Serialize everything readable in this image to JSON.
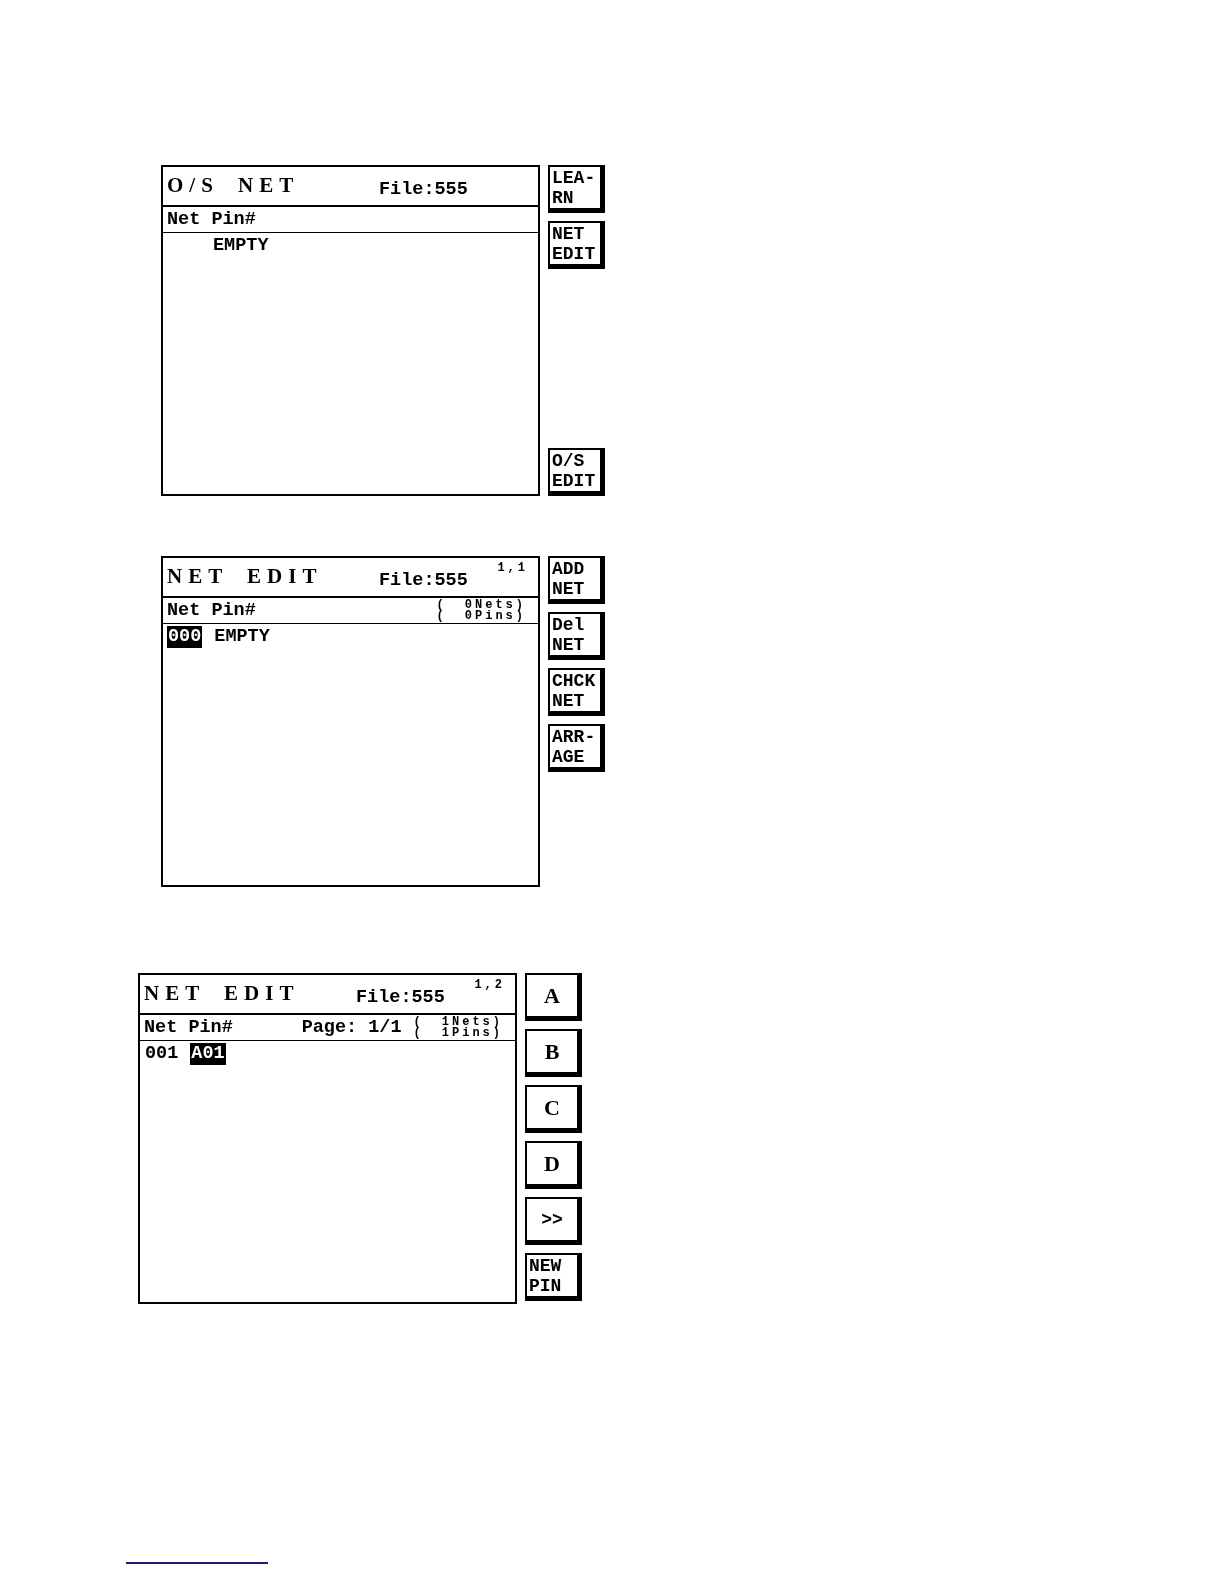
{
  "screens": [
    {
      "title": "O/S NET",
      "file": "File:555",
      "header": {
        "column_label": "Net Pin#"
      },
      "rows": [
        {
          "pin": {
            "text": "EMPTY",
            "selected": false
          }
        }
      ],
      "side_buttons": [
        {
          "kind": "label",
          "lines": [
            "LEA-",
            "RN"
          ]
        },
        {
          "kind": "label",
          "lines": [
            "NET",
            "EDIT"
          ]
        }
      ],
      "bottom_buttons": [
        {
          "kind": "label",
          "lines": [
            "O/S",
            "EDIT"
          ]
        }
      ]
    },
    {
      "title": "NET EDIT",
      "file": "File:555",
      "cursor": "1,1",
      "header": {
        "column_label": "Net Pin#",
        "counts": [
          {
            "bracket": "(",
            "count": "0Nets)"
          },
          {
            "bracket": "(",
            "count": "0Pins)"
          }
        ]
      },
      "rows": [
        {
          "net": {
            "text": "000",
            "selected": true
          },
          "pin": {
            "text": "EMPTY",
            "selected": false
          }
        }
      ],
      "side_buttons": [
        {
          "kind": "label",
          "lines": [
            "ADD",
            "NET"
          ]
        },
        {
          "kind": "label",
          "lines": [
            "Del",
            "NET"
          ]
        },
        {
          "kind": "label",
          "lines": [
            "CHCK",
            "NET"
          ]
        },
        {
          "kind": "label",
          "lines": [
            "ARR-",
            "AGE"
          ]
        }
      ]
    },
    {
      "title": "NET EDIT",
      "file": "File:555",
      "cursor": "1,2",
      "header": {
        "column_label": "Net Pin#",
        "page": "Page: 1/1",
        "counts": [
          {
            "bracket": "(",
            "count": "1Nets)"
          },
          {
            "bracket": "(",
            "count": "1Pins)"
          }
        ]
      },
      "rows": [
        {
          "net": {
            "text": "001",
            "selected": false
          },
          "pin": {
            "text": "A01",
            "selected": true
          }
        }
      ],
      "side_buttons": [
        {
          "kind": "letter",
          "lines": [
            "A"
          ]
        },
        {
          "kind": "letter",
          "lines": [
            "B"
          ]
        },
        {
          "kind": "letter",
          "lines": [
            "C"
          ]
        },
        {
          "kind": "letter",
          "lines": [
            "D"
          ]
        },
        {
          "kind": "symbol",
          "lines": [
            ">>"
          ]
        },
        {
          "kind": "label",
          "lines": [
            "NEW",
            "PIN"
          ]
        }
      ]
    }
  ]
}
